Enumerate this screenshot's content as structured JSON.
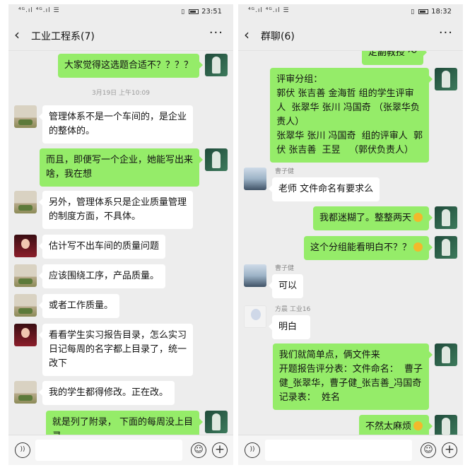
{
  "left": {
    "status": {
      "signal": "⁴ᴳ.ıl ⁴ᴳ.ıl ☰",
      "time": "23:51"
    },
    "header": {
      "title": "工业工程系(7)"
    },
    "timestamp": "3月19日 上午10:09",
    "messages": [
      {
        "text": "大家觉得这选题合适不？？？？"
      },
      {
        "text": "管理体系不是一个车间的，是企业\n的整体的。"
      },
      {
        "text": "而且，即便写一个企业，她能写出来\n啥，我在想"
      },
      {
        "text": "另外，管理体系只是企业质量管理\n的制度方面，不具体。"
      },
      {
        "text": "估计写不出车间的质量问题"
      },
      {
        "text": "应该围绕工序，产品质量。"
      },
      {
        "text": "或者工作质量。"
      },
      {
        "text": "看看学生实习报告目录，怎么实习\n日记每周的名字都上目录了，统一\n改下"
      },
      {
        "text": "我的学生都得修改。正在改。"
      },
      {
        "text": "就是列了附录， 下面的每周没上目\n录"
      }
    ]
  },
  "right": {
    "status": {
      "signal": "⁴ᴳ.ıl ⁴ᴳ.ıl ☰",
      "time": "18:32"
    },
    "header": {
      "title": "群聊(6)"
    },
    "messages": [
      {
        "text": "定副教授 ～"
      },
      {
        "text": "评审分组：\n郭伏 张吉善 金海哲 组的学生评审\n人  张翠华 张川 冯国奇 （张翠华负\n责人）\n张翠华 张川 冯国奇  组的评审人  郭\n伏 张吉善  王昱   （郭伏负责人）"
      },
      {
        "sender": "曹子健",
        "text": "老师 文件命名有要求么"
      },
      {
        "text": "我都迷糊了。整整两天"
      },
      {
        "text": "这个分组能看明白不？？"
      },
      {
        "sender": "曹子健",
        "text": "可以"
      },
      {
        "sender": "方晨 工业16",
        "text": "明白"
      },
      {
        "text": "我们就简单点，俩文件来\n开题报告评分表：文件命名：  曹子\n健_张翠华，曹子健_张吉善_冯国奇\n记录表：  姓名"
      },
      {
        "text": "不然太麻烦"
      }
    ]
  },
  "icons": {
    "back": "‹",
    "more": "···",
    "voice": "voice-icon",
    "emoji": "smiley-icon",
    "plus": "plus-icon"
  },
  "colors": {
    "outgoing_bubble": "#95ec69",
    "incoming_bubble": "#ffffff",
    "background": "#ededed"
  }
}
